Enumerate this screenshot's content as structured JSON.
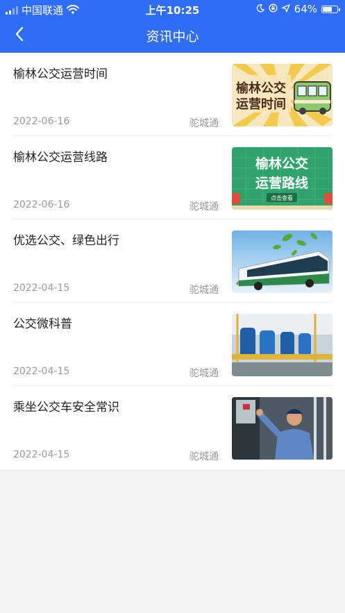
{
  "status_bar": {
    "carrier": "中国联通",
    "time": "上午10:25",
    "battery": "64%"
  },
  "header": {
    "title": "资讯中心"
  },
  "articles": [
    {
      "title": "榆林公交运营时间",
      "date": "2022-06-16",
      "source": "驼城通",
      "thumb": {
        "line1": "榆林公交",
        "line2": "运营时间"
      }
    },
    {
      "title": "榆林公交运营线路",
      "date": "2022-06-16",
      "source": "驼城通",
      "thumb": {
        "line1": "榆林公交",
        "line2": "运营路线",
        "button": "点击查看"
      }
    },
    {
      "title": "优选公交、绿色出行",
      "date": "2022-04-15",
      "source": "驼城通"
    },
    {
      "title": "公交微科普",
      "date": "2022-04-15",
      "source": "驼城通"
    },
    {
      "title": "乘坐公交车安全常识",
      "date": "2022-04-15",
      "source": "驼城通"
    }
  ],
  "colors": {
    "header_bg": "#2f6df5",
    "page_bg": "#f4f4f4",
    "title_text": "#222222",
    "meta_text": "#9a9a9a"
  },
  "icons": {
    "back": "chevron-left-icon",
    "wifi": "wifi-icon",
    "signal": "signal-icon",
    "moon": "moon-icon",
    "lock_rotation": "orientation-lock-icon",
    "location": "location-arrow-icon",
    "battery": "battery-icon"
  }
}
